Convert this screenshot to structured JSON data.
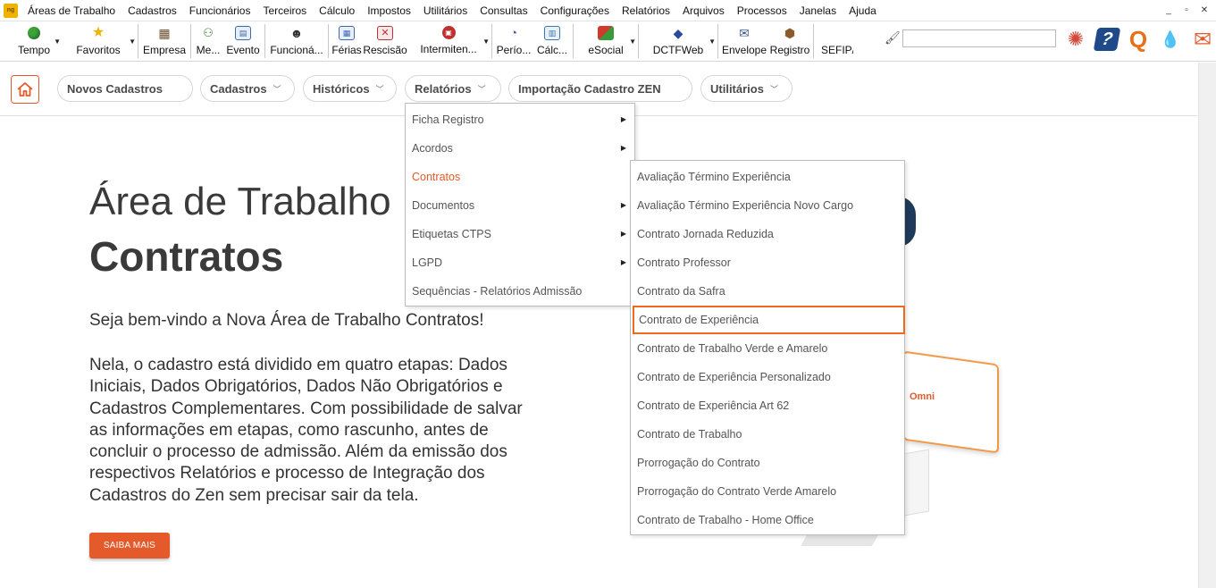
{
  "menubar": {
    "app_icon_label": "ng",
    "items": [
      "Áreas de Trabalho",
      "Cadastros",
      "Funcionários",
      "Terceiros",
      "Cálculo",
      "Impostos",
      "Utilitários",
      "Consultas",
      "Configurações",
      "Relatórios",
      "Arquivos",
      "Processos",
      "Janelas",
      "Ajuda"
    ],
    "window_controls": [
      "_",
      "▫",
      "✕"
    ]
  },
  "toolbar": {
    "items": [
      {
        "label": "Tempo",
        "icon": "weather-icon",
        "color": "#3aa43a",
        "dropdown": true
      },
      {
        "label": "Favoritos",
        "icon": "star-icon",
        "color": "#f0b400",
        "dropdown": true
      },
      {
        "label": "Empresa",
        "icon": "building-icon",
        "color": "#6b4a2a",
        "dropdown": false
      },
      {
        "label": "Me...",
        "icon": "people-icon",
        "color": "#3a7a3a",
        "dropdown": false
      },
      {
        "label": "Evento",
        "icon": "event-icon",
        "color": "#3a6ab0",
        "dropdown": false
      },
      {
        "label": "Funcioná...",
        "icon": "employee-icon",
        "color": "#333333",
        "dropdown": false
      },
      {
        "label": "Férias",
        "icon": "vacation-icon",
        "color": "#3a6ab0",
        "dropdown": false
      },
      {
        "label": "Rescisão",
        "icon": "termination-icon",
        "color": "#c03030",
        "dropdown": false
      },
      {
        "label": "Intermiten...",
        "icon": "intermittent-icon",
        "color": "#c03030",
        "dropdown": true
      },
      {
        "label": "Perío...",
        "icon": "period-icon",
        "color": "#6a3aa0",
        "dropdown": false
      },
      {
        "label": "Cálc...",
        "icon": "calc-icon",
        "color": "#3a7ab0",
        "dropdown": false
      },
      {
        "label": "eSocial",
        "icon": "esocial-icon",
        "color": "#d03a2a",
        "dropdown": true
      },
      {
        "label": "DCTFWeb",
        "icon": "dctfweb-icon",
        "color": "#2a4a9a",
        "dropdown": true
      },
      {
        "label": "Envelope",
        "icon": "envelope-icon",
        "color": "#3a5a9a",
        "dropdown": false
      },
      {
        "label": "Registro",
        "icon": "register-icon",
        "color": "#8a5a2a",
        "dropdown": false
      },
      {
        "label": "SEFIP/F",
        "icon": "sefip-icon",
        "color": "#555555",
        "dropdown": false
      }
    ],
    "search_placeholder": "",
    "right_icons": [
      {
        "name": "sun-settings-icon",
        "glyph": "✺",
        "color": "#d04a3a"
      },
      {
        "name": "help-icon",
        "glyph": "?",
        "color": "#1e4a8a"
      },
      {
        "name": "q-logo-icon",
        "glyph": "Q",
        "color": "#e8701a"
      },
      {
        "name": "water-drop-icon",
        "glyph": "💧",
        "color": "#3a9ad0"
      },
      {
        "name": "mail-alert-icon",
        "glyph": "✉",
        "color": "#e45a2a"
      }
    ]
  },
  "nav": {
    "home_icon": "home-icon",
    "pills": [
      {
        "label": "Novos Cadastros",
        "chevron": false
      },
      {
        "label": "Cadastros",
        "chevron": true
      },
      {
        "label": "Históricos",
        "chevron": true
      },
      {
        "label": "Relatórios",
        "chevron": true
      },
      {
        "label": "Importação Cadastro ZEN",
        "chevron": false
      },
      {
        "label": "Utilitários",
        "chevron": true
      }
    ]
  },
  "main": {
    "title": "Área de Trabalho",
    "subtitle": "Contratos",
    "welcome": "Seja bem-vindo a Nova Área de Trabalho Contratos!",
    "description": "Nela, o cadastro está dividido em quatro etapas: Dados Iniciais, Dados Obrigatórios, Dados Não Obrigatórios e Cadastros Complementares. Com possibilidade de salvar as informações em etapas, como rascunho, antes de concluir o processo de admissão. Além da emissão dos respectivos Relatórios e processo de Integração dos Cadastros do Zen sem precisar sair da tela.",
    "button": "SAIBA MAIS",
    "art_logo_text": "Omni"
  },
  "relatorios_menu": {
    "items": [
      {
        "label": "Ficha Registro",
        "submenu": true,
        "active": false
      },
      {
        "label": "Acordos",
        "submenu": true,
        "active": false
      },
      {
        "label": "Contratos",
        "submenu": false,
        "active": true
      },
      {
        "label": "Documentos",
        "submenu": true,
        "active": false
      },
      {
        "label": "Etiquetas CTPS",
        "submenu": true,
        "active": false
      },
      {
        "label": "LGPD",
        "submenu": true,
        "active": false
      },
      {
        "label": "Sequências - Relatórios Admissão",
        "submenu": false,
        "active": false
      }
    ]
  },
  "contratos_submenu": {
    "items": [
      {
        "label": "Avaliação Término Experiência",
        "highlighted": false
      },
      {
        "label": "Avaliação Término Experiência Novo Cargo",
        "highlighted": false
      },
      {
        "label": "Contrato Jornada Reduzida",
        "highlighted": false
      },
      {
        "label": "Contrato Professor",
        "highlighted": false
      },
      {
        "label": "Contrato da Safra",
        "highlighted": false
      },
      {
        "label": "Contrato de Experiência",
        "highlighted": true
      },
      {
        "label": "Contrato de Trabalho Verde e Amarelo",
        "highlighted": false
      },
      {
        "label": "Contrato de Experiência Personalizado",
        "highlighted": false
      },
      {
        "label": "Contrato de Experiência Art 62",
        "highlighted": false
      },
      {
        "label": "Contrato de Trabalho",
        "highlighted": false
      },
      {
        "label": "Prorrogação do Contrato",
        "highlighted": false
      },
      {
        "label": "Prorrogação do Contrato Verde Amarelo",
        "highlighted": false
      },
      {
        "label": "Contrato de Trabalho - Home Office",
        "highlighted": false
      }
    ]
  },
  "colors": {
    "accent": "#e45a2a",
    "highlight_border": "#f06a1c",
    "text_dark": "#3a3a3a"
  }
}
